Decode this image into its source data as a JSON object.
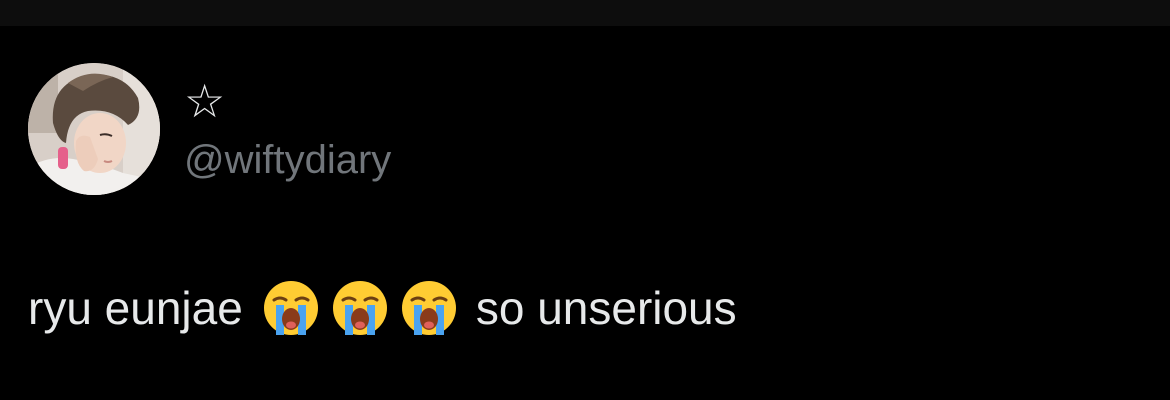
{
  "tweet": {
    "author": {
      "display_name": "☆",
      "handle": "@wiftydiary",
      "avatar_icon": "profile-photo"
    },
    "text": {
      "before_emoji": "ryu eunjae",
      "emoji": [
        "loudly-crying-face",
        "loudly-crying-face",
        "loudly-crying-face"
      ],
      "after_emoji": "so unserious"
    }
  },
  "colors": {
    "background": "#000000",
    "top_bar": "#0d0d0d",
    "primary_text": "#e7e9ea",
    "secondary_text": "#71767b"
  }
}
